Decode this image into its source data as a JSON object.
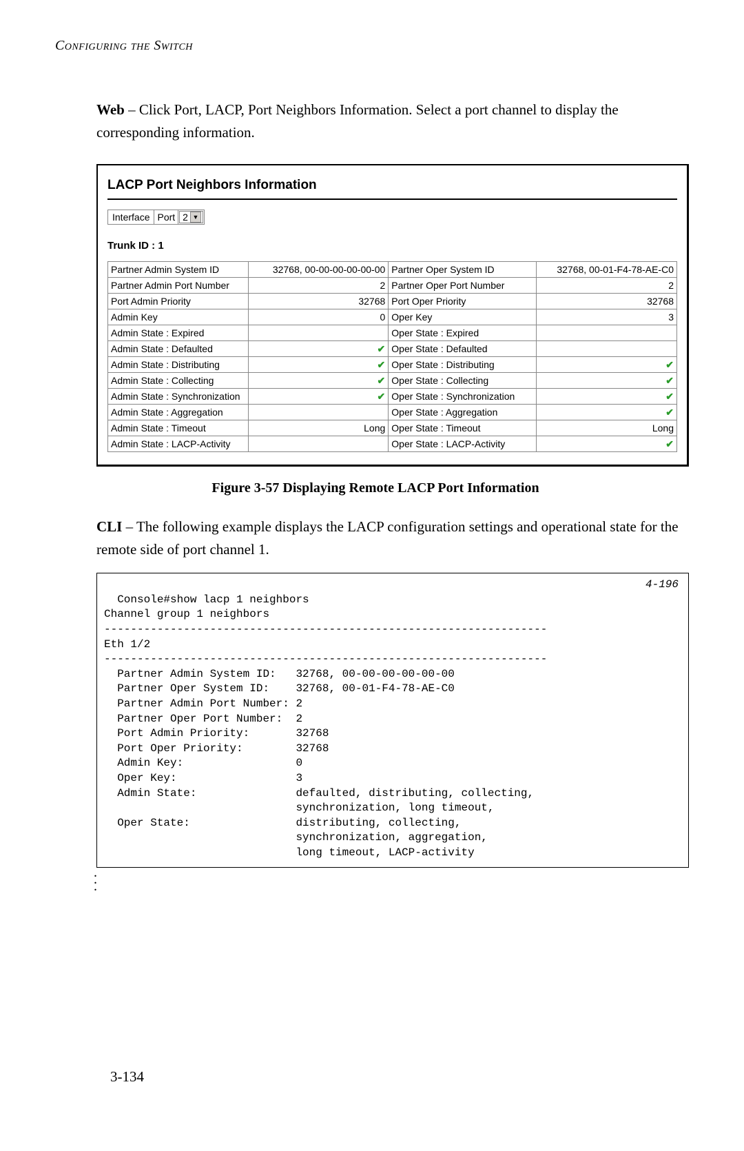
{
  "header": "Configuring the Switch",
  "intro": {
    "bold": "Web",
    "text": " – Click Port, LACP, Port Neighbors Information. Select a port channel to display the corresponding information."
  },
  "panel": {
    "title": "LACP Port Neighbors Information",
    "interface_label": "Interface",
    "interface_type": "Port",
    "interface_port": "2",
    "trunk": "Trunk ID : 1",
    "rows": [
      {
        "k": "Partner Admin System ID",
        "v": "32768, 00-00-00-00-00-00",
        "k2": "Partner Oper System ID",
        "v2": "32768, 00-01-F4-78-AE-C0",
        "c1": "",
        "c2": ""
      },
      {
        "k": "Partner Admin Port Number",
        "v": "2",
        "k2": "Partner Oper Port Number",
        "v2": "2",
        "c1": "",
        "c2": ""
      },
      {
        "k": "Port Admin Priority",
        "v": "32768",
        "k2": "Port Oper Priority",
        "v2": "32768",
        "c1": "",
        "c2": ""
      },
      {
        "k": "Admin Key",
        "v": "0",
        "k2": "Oper Key",
        "v2": "3",
        "c1": "",
        "c2": ""
      },
      {
        "k": "Admin State : Expired",
        "v": "",
        "k2": "Oper State : Expired",
        "v2": "",
        "c1": "",
        "c2": ""
      },
      {
        "k": "Admin State : Defaulted",
        "v": "",
        "k2": "Oper State : Defaulted",
        "v2": "",
        "c1": "check",
        "c2": ""
      },
      {
        "k": "Admin State : Distributing",
        "v": "",
        "k2": "Oper State : Distributing",
        "v2": "",
        "c1": "check",
        "c2": "check"
      },
      {
        "k": "Admin State : Collecting",
        "v": "",
        "k2": "Oper State : Collecting",
        "v2": "",
        "c1": "check",
        "c2": "check"
      },
      {
        "k": "Admin State : Synchronization",
        "v": "",
        "k2": "Oper State : Synchronization",
        "v2": "",
        "c1": "check",
        "c2": "check"
      },
      {
        "k": "Admin State : Aggregation",
        "v": "",
        "k2": "Oper State : Aggregation",
        "v2": "",
        "c1": "",
        "c2": "check"
      },
      {
        "k": "Admin State : Timeout",
        "v": "Long",
        "k2": "Oper State : Timeout",
        "v2": "Long",
        "c1": "",
        "c2": ""
      },
      {
        "k": "Admin State : LACP-Activity",
        "v": "",
        "k2": "Oper State : LACP-Activity",
        "v2": "",
        "c1": "",
        "c2": "check"
      }
    ]
  },
  "figure_caption": "Figure 3-57  Displaying Remote LACP Port Information",
  "cli_intro": {
    "bold": "CLI",
    "text": " – The following example displays the LACP configuration settings and operational state for the remote side of port channel 1."
  },
  "cli_ref": "4-196",
  "cli_text": "Console#show lacp 1 neighbors\nChannel group 1 neighbors\n-------------------------------------------------------------------\nEth 1/2\n-------------------------------------------------------------------\n  Partner Admin System ID:   32768, 00-00-00-00-00-00\n  Partner Oper System ID:    32768, 00-01-F4-78-AE-C0\n  Partner Admin Port Number: 2\n  Partner Oper Port Number:  2\n  Port Admin Priority:       32768\n  Port Oper Priority:        32768\n  Admin Key:                 0\n  Oper Key:                  3\n  Admin State:               defaulted, distributing, collecting,\n                             synchronization, long timeout,\n  Oper State:                distributing, collecting,\n                             synchronization, aggregation,\n                             long timeout, LACP-activity",
  "page_number": "3-134"
}
